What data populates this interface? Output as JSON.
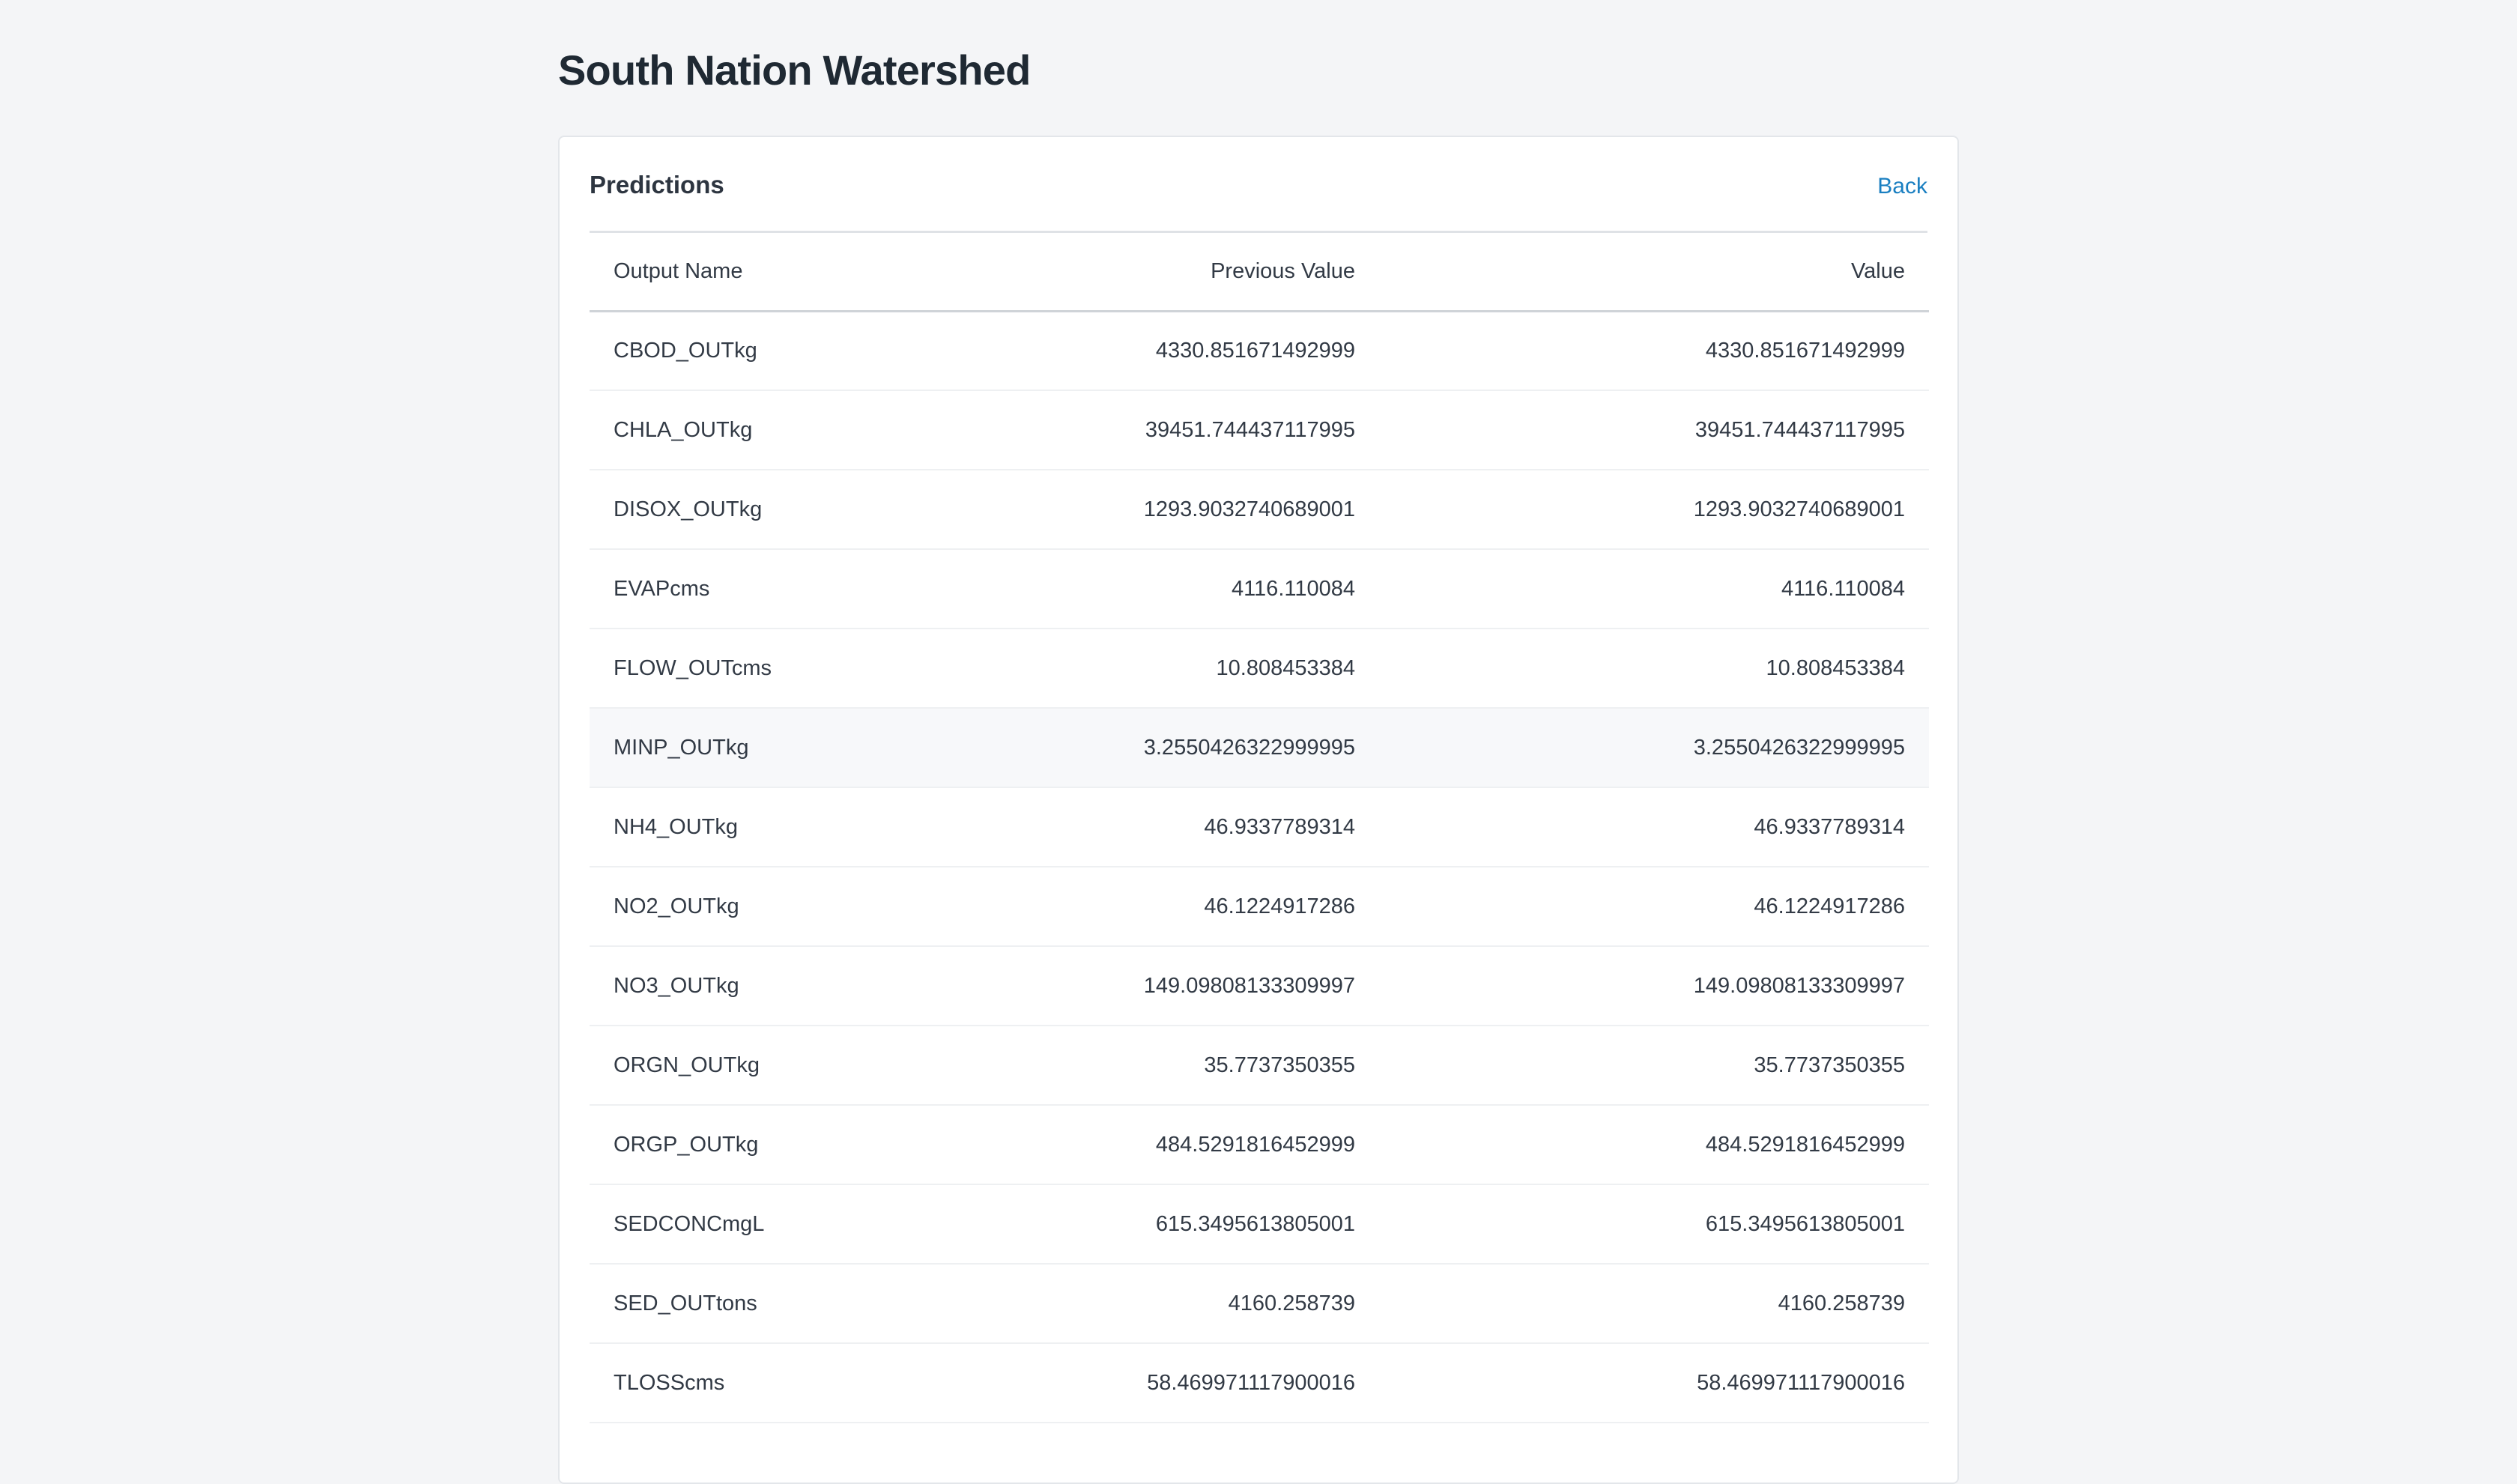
{
  "page": {
    "title": "South Nation Watershed"
  },
  "card": {
    "title": "Predictions",
    "back_label": "Back"
  },
  "table": {
    "headers": {
      "output_name": "Output Name",
      "previous_value": "Previous Value",
      "value": "Value"
    },
    "rows": [
      {
        "name": "CBOD_OUTkg",
        "previous": "4330.851671492999",
        "value": "4330.851671492999"
      },
      {
        "name": "CHLA_OUTkg",
        "previous": "39451.744437117995",
        "value": "39451.744437117995"
      },
      {
        "name": "DISOX_OUTkg",
        "previous": "1293.9032740689001",
        "value": "1293.9032740689001"
      },
      {
        "name": "EVAPcms",
        "previous": "4116.110084",
        "value": "4116.110084"
      },
      {
        "name": "FLOW_OUTcms",
        "previous": "10.808453384",
        "value": "10.808453384"
      },
      {
        "name": "MINP_OUTkg",
        "previous": "3.2550426322999995",
        "value": "3.2550426322999995"
      },
      {
        "name": "NH4_OUTkg",
        "previous": "46.9337789314",
        "value": "46.9337789314"
      },
      {
        "name": "NO2_OUTkg",
        "previous": "46.1224917286",
        "value": "46.1224917286"
      },
      {
        "name": "NO3_OUTkg",
        "previous": "149.09808133309997",
        "value": "149.09808133309997"
      },
      {
        "name": "ORGN_OUTkg",
        "previous": "35.7737350355",
        "value": "35.7737350355"
      },
      {
        "name": "ORGP_OUTkg",
        "previous": "484.5291816452999",
        "value": "484.5291816452999"
      },
      {
        "name": "SEDCONCmgL",
        "previous": "615.3495613805001",
        "value": "615.3495613805001"
      },
      {
        "name": "SED_OUTtons",
        "previous": "4160.258739",
        "value": "4160.258739"
      },
      {
        "name": "TLOSScms",
        "previous": "58.469971117900016",
        "value": "58.469971117900016"
      }
    ]
  },
  "colors": {
    "background": "#f4f5f7",
    "card": "#ffffff",
    "link": "#1a7fc1",
    "row_hover": "#f7f8fa"
  }
}
